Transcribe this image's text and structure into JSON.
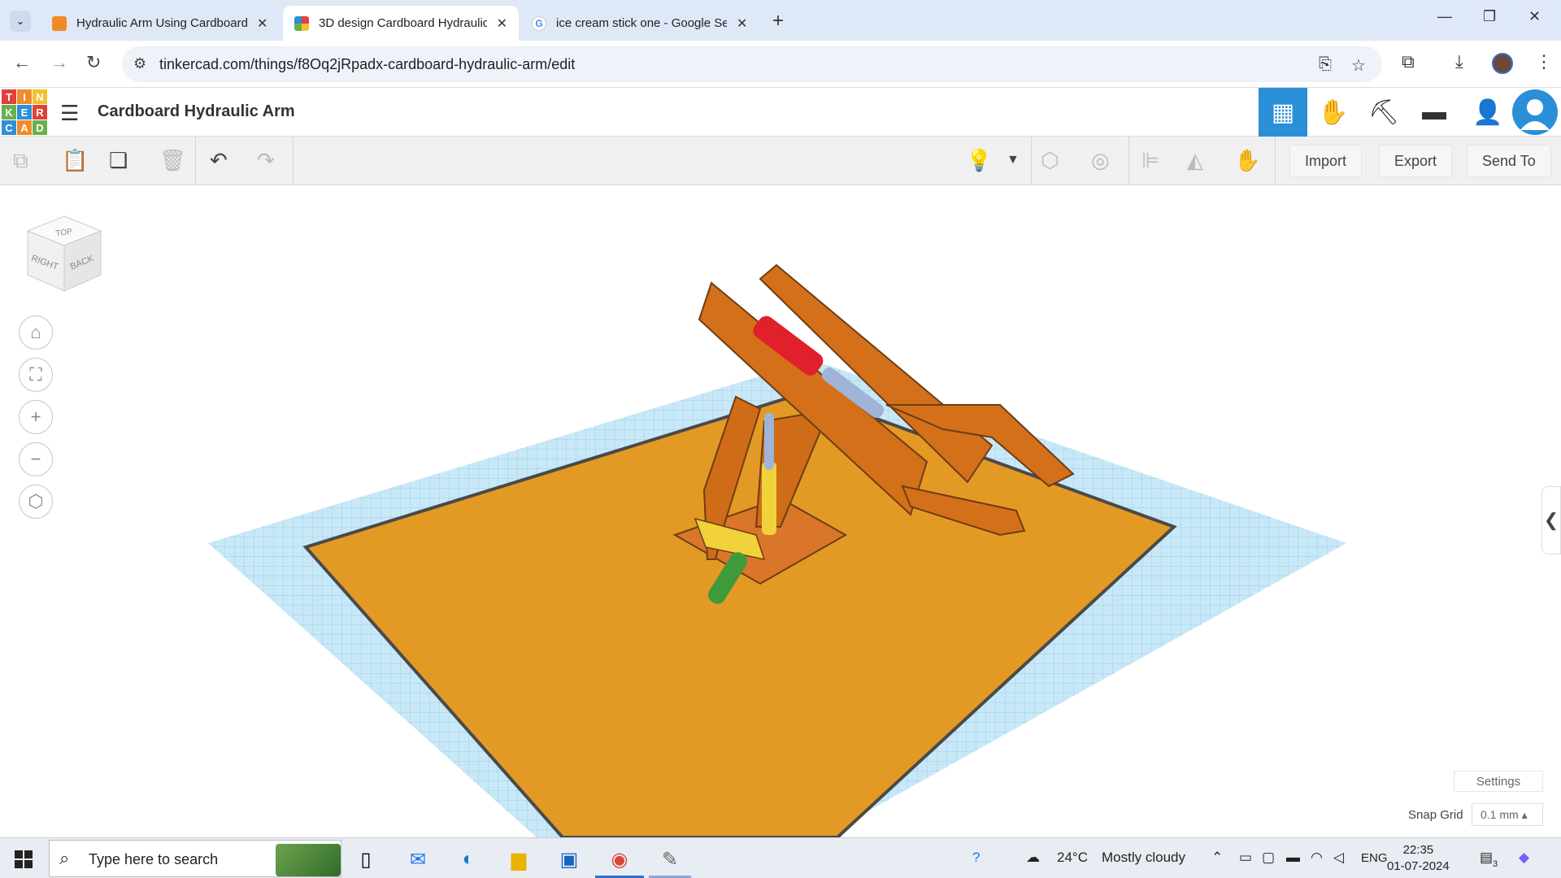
{
  "browser": {
    "tabs": [
      {
        "title": "Hydraulic Arm Using Cardboard",
        "favicon_color": "#f08a24",
        "active": false
      },
      {
        "title": "3D design Cardboard Hydraulic",
        "favicon_color": "#3a8fd6",
        "active": true
      },
      {
        "title": "ice cream stick one - Google Se",
        "favicon_color": "#ffffff",
        "active": false
      }
    ],
    "url": "tinkercad.com/things/f8Oq2jRpadx-cardboard-hydraulic-arm/edit"
  },
  "app": {
    "logo_letters": [
      "T",
      "I",
      "N",
      "K",
      "E",
      "R",
      "C",
      "A",
      "D"
    ],
    "logo_colors": [
      "#e2403a",
      "#f28c28",
      "#f2c12e",
      "#6ab04c",
      "#2d8fd5",
      "#e2403a",
      "#2d8fd5",
      "#f28c28",
      "#6ab04c"
    ],
    "design_title": "Cardboard Hydraulic Arm",
    "mode_icons": [
      "grid-view-icon",
      "codeblocks-icon",
      "minecraft-pickaxe-icon",
      "bricks-icon",
      "add-user-icon",
      "profile-icon"
    ]
  },
  "toolbar": {
    "import_label": "Import",
    "export_label": "Export",
    "sendto_label": "Send To"
  },
  "workplane": {
    "viewcube_faces": {
      "top": "TOP",
      "right": "RIGHT",
      "back": "BACK"
    },
    "settings_label": "Settings",
    "snap_grid_label": "Snap Grid",
    "snap_grid_value": "0.1 mm ▴"
  },
  "taskbar": {
    "search_placeholder": "Type here to search",
    "weather_temp": "24°C",
    "weather_desc": "Mostly cloudy",
    "lang": "ENG",
    "time": "22:35",
    "date": "01-07-2024",
    "notif_count": "3"
  }
}
